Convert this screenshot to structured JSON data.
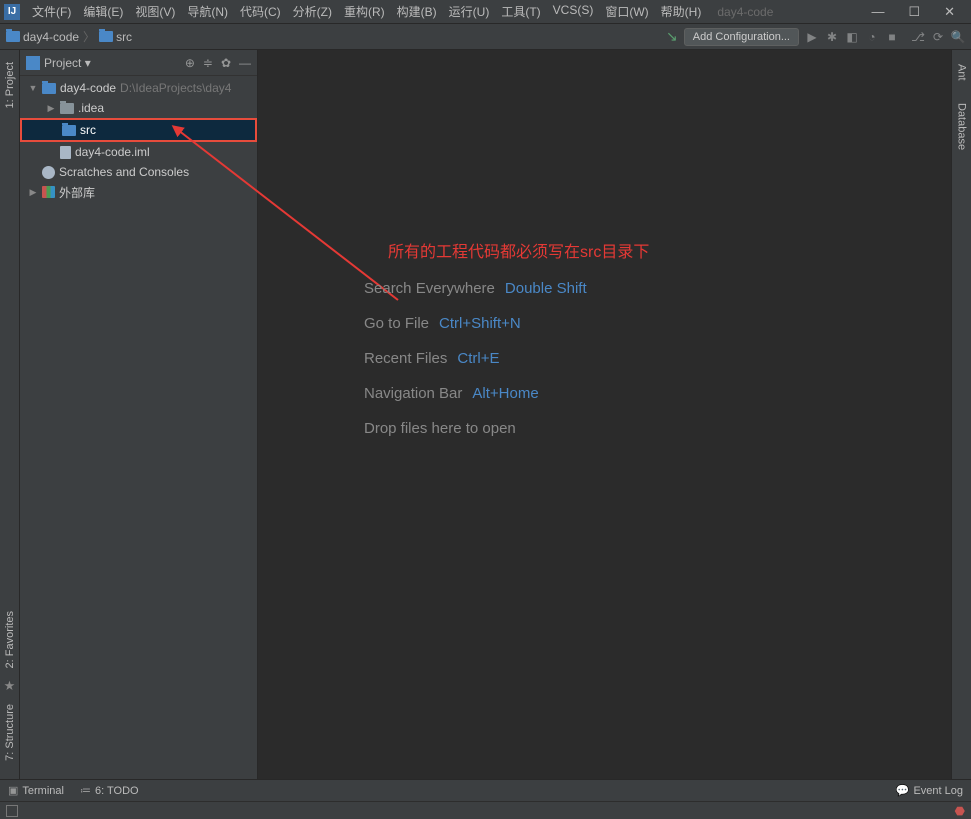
{
  "menu": {
    "file": "文件(F)",
    "edit": "编辑(E)",
    "view": "视图(V)",
    "navigate": "导航(N)",
    "code": "代码(C)",
    "analyze": "分析(Z)",
    "refactor": "重构(R)",
    "build": "构建(B)",
    "run": "运行(U)",
    "tools": "工具(T)",
    "vcs": "VCS(S)",
    "window": "窗口(W)",
    "help": "帮助(H)"
  },
  "title": {
    "project": "day4-code"
  },
  "breadcrumb": {
    "root": "day4-code",
    "child": "src"
  },
  "toolbar": {
    "addConfig": "Add Configuration..."
  },
  "projectPanel": {
    "label": "Project"
  },
  "tree": {
    "root": "day4-code",
    "rootPath": "D:\\IdeaProjects\\day4",
    "idea": ".idea",
    "src": "src",
    "iml": "day4-code.iml",
    "scratches": "Scratches and Consoles",
    "external": "外部库"
  },
  "annotation": "所有的工程代码都必须写在src目录下",
  "hints": {
    "searchLabel": "Search Everywhere",
    "searchKey": "Double Shift",
    "gotoLabel": "Go to File",
    "gotoKey": "Ctrl+Shift+N",
    "recentLabel": "Recent Files",
    "recentKey": "Ctrl+E",
    "navLabel": "Navigation Bar",
    "navKey": "Alt+Home",
    "drop": "Drop files here to open"
  },
  "leftTabs": {
    "project": "1: Project",
    "favorites": "2: Favorites",
    "structure": "7: Structure"
  },
  "rightTabs": {
    "ant": "Ant",
    "database": "Database"
  },
  "bottom": {
    "terminal": "Terminal",
    "todo": "6: TODO",
    "eventLog": "Event Log"
  }
}
